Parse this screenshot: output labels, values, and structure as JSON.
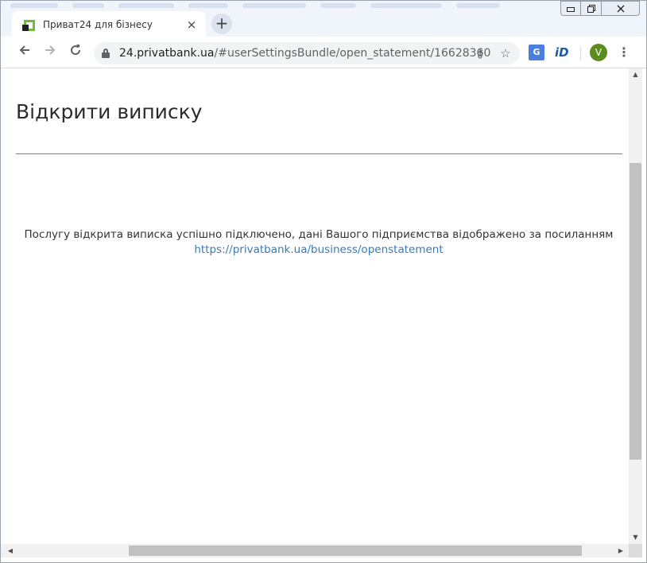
{
  "browser": {
    "tab": {
      "title": "Приват24 для бізнесу",
      "close_icon": "×",
      "favicon": "privat24-logo"
    },
    "new_tab_label": "+",
    "window_controls": {
      "minimize": "▭",
      "maximize": "⧉",
      "close": "✕"
    },
    "nav": {
      "back": "←",
      "forward": "→",
      "reload": "↻"
    },
    "address": {
      "domain": "24.privatbank.ua",
      "path": "/#userSettingsBundle/open_statement/16628360"
    },
    "omnibox_icons": {
      "key": "⚷",
      "star": "☆"
    },
    "extensions": {
      "translate": "G",
      "id": "iD"
    },
    "profile_initial": "V",
    "menu": "⋮"
  },
  "page": {
    "title": "Відкрити виписку",
    "message": "Послугу відкрита виписка успішно підключено, дані Вашого підприємства відображено за посиланням",
    "link": "https://privatbank.ua/business/openstatement"
  },
  "colors": {
    "link": "#3a7ab8",
    "avatar": "#5b8c1f",
    "favicon_green": "#74b741"
  }
}
